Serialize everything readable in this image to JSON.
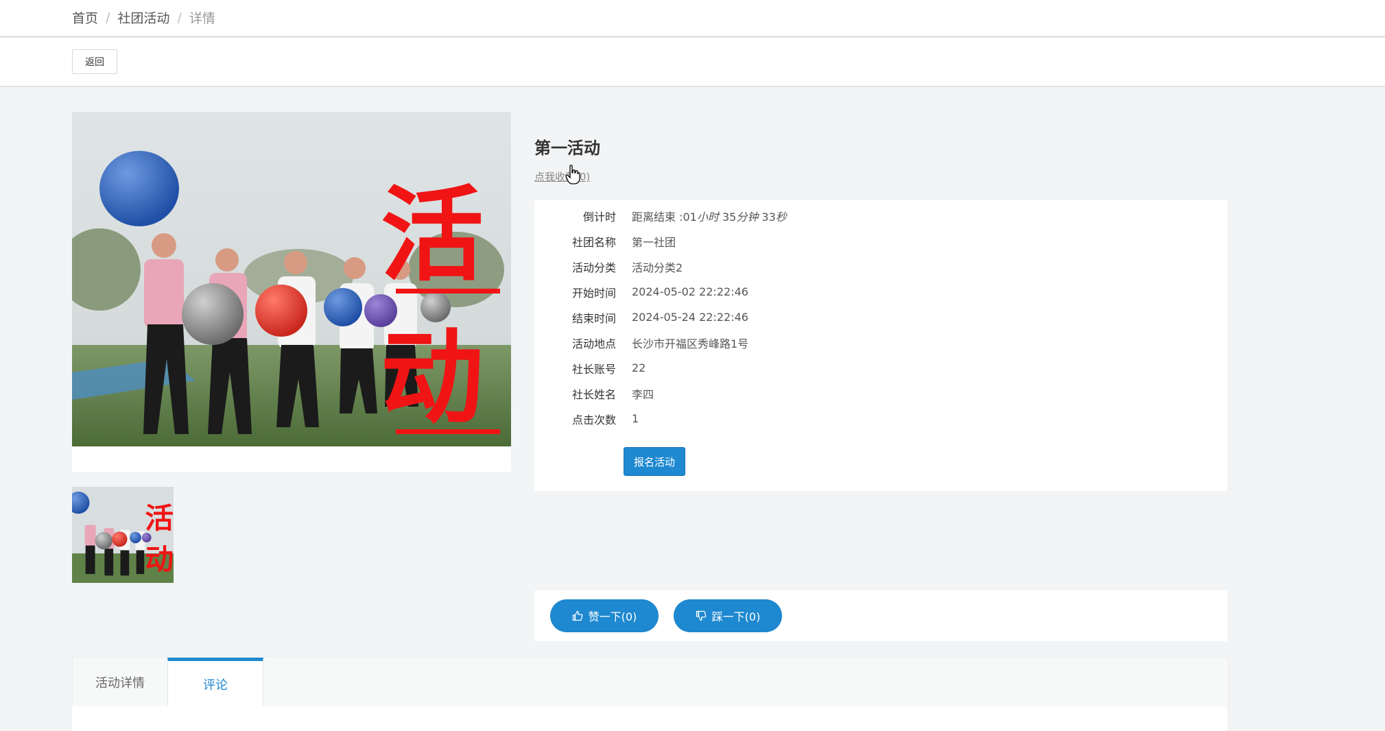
{
  "breadcrumb": {
    "home": "首页",
    "section": "社团活动",
    "current": "详情",
    "separator": "/"
  },
  "toolbar": {
    "back_label": "返回"
  },
  "image": {
    "overlay_char1": "活",
    "overlay_char2": "动"
  },
  "activity": {
    "title": "第一活动",
    "favorite_label": "点我收藏(0)"
  },
  "details": {
    "countdown": {
      "label": "倒计时",
      "prefix": "距离结束 :01",
      "hour_unit": "小时",
      "minutes": "35",
      "minute_unit": "分钟",
      "seconds": "33",
      "second_unit": "秒"
    },
    "club_name": {
      "label": "社团名称",
      "value": "第一社团"
    },
    "category": {
      "label": "活动分类",
      "value": "活动分类2"
    },
    "start_time": {
      "label": "开始时间",
      "value": "2024-05-02 22:22:46"
    },
    "end_time": {
      "label": "结束时间",
      "value": "2024-05-24 22:22:46"
    },
    "location": {
      "label": "活动地点",
      "value": "长沙市开福区秀峰路1号"
    },
    "leader_account": {
      "label": "社长账号",
      "value": "22"
    },
    "leader_name": {
      "label": "社长姓名",
      "value": "李四"
    },
    "click_count": {
      "label": "点击次数",
      "value": "1"
    }
  },
  "actions": {
    "join_label": "报名活动"
  },
  "vote": {
    "like_label": "赞一下(0)",
    "dislike_label": "踩一下(0)"
  },
  "tabs": [
    {
      "label": "活动详情",
      "active": false
    },
    {
      "label": "评论",
      "active": true
    }
  ],
  "colors": {
    "accent": "#1e88d0",
    "overlay_red": "#f01414"
  }
}
